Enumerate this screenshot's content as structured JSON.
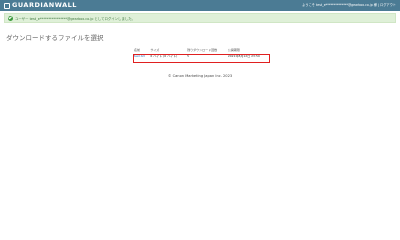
{
  "header": {
    "logo_text": "GUARDIANWALL",
    "user_text": "ようこそ test_e**************@gearbox.co.jp 様 | ログアウト"
  },
  "alert": {
    "message": "ユーザー test_e****************@gearbox.co.jp としてログインしました。"
  },
  "page_title": "ダウンロードするファイルを選択",
  "table": {
    "headers": [
      "名前",
      "サイズ",
      "残りダウンロード回数",
      "公開期限"
    ],
    "rows": [
      {
        "name": "test.txt",
        "size": "6 バイト (6 バイト)",
        "remaining": "5",
        "expiry": "2021年8月12日 23:59"
      }
    ]
  },
  "footer": "© Canon Marketing Japan Inc. 2023",
  "colors": {
    "topbar": "#4b7b94",
    "alert_bg": "#dff0d8",
    "highlight": "#e02020"
  }
}
